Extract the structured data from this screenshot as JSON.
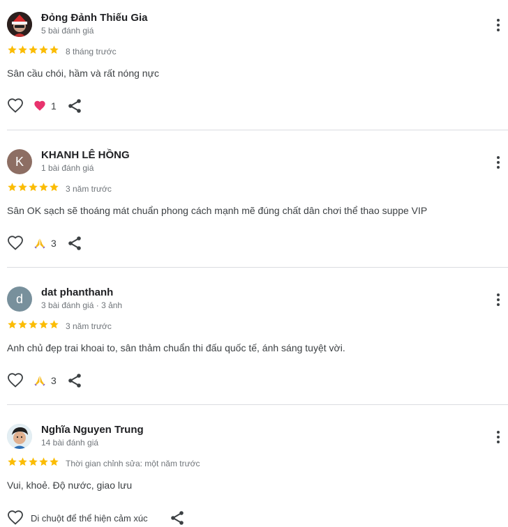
{
  "reviews": [
    {
      "name": "Đỏng Đảnh Thiếu Gia",
      "meta": "5 bài đánh giá",
      "avatar_letter": "",
      "rating": 5,
      "date": "8 tháng trước",
      "text": "Sân cầu chói, hầm và rất nóng nực",
      "reaction_icon": "heart-reaction-icon",
      "reaction_count": "1"
    },
    {
      "name": "KHANH LÊ HỒNG",
      "meta": "1 bài đánh giá",
      "avatar_letter": "K",
      "avatar_color": "#8d6e63",
      "rating": 5,
      "date": "3 năm trước",
      "text": "Sân OK sạch sẽ thoáng mát chuẩn phong cách mạnh mẽ đúng chất dân chơi thể thao suppe VIP",
      "reaction_icon": "praying-hands-reaction-icon",
      "reaction_count": "3"
    },
    {
      "name": "dat phanthanh",
      "meta": "3 bài đánh giá · 3 ảnh",
      "avatar_letter": "d",
      "avatar_color": "#78909c",
      "rating": 5,
      "date": "3 năm trước",
      "text": "Anh chủ đẹp trai khoai to, sân thảm chuẩn thi đấu quốc tế, ánh sáng tuyệt vời.",
      "reaction_icon": "praying-hands-reaction-icon",
      "reaction_count": "3"
    },
    {
      "name": "Nghĩa Nguyen Trung",
      "meta": "14 bài đánh giá",
      "avatar_letter": "",
      "rating": 5,
      "date": "Thời gian chỉnh sửa: một năm trước",
      "text": "Vui, khoẻ. Độ nước, giao lưu",
      "hover_hint": "Di chuột để thể hiện cảm xúc"
    }
  ],
  "colors": {
    "star": "#fbbc04",
    "heart_reaction": "#e8336d",
    "icon": "#3c4043",
    "divider": "#dadce0"
  }
}
